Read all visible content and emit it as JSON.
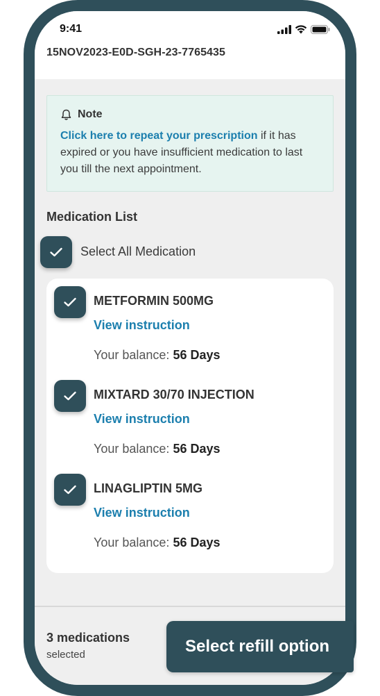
{
  "status_bar": {
    "time": "9:41"
  },
  "header": {
    "reference": "15NOV2023-E0D-SGH-23-7765435"
  },
  "note": {
    "title": "Note",
    "link_text": "Click here to repeat your prescription",
    "body_text": " if it has expired or you have insufficient medication to last you till the next appointment."
  },
  "medication_list": {
    "title": "Medication List",
    "select_all_label": "Select All Medication",
    "balance_prefix": "Your balance: ",
    "items": [
      {
        "name": "METFORMIN 500MG",
        "link": "View instruction",
        "balance": "56 Days",
        "checked": true
      },
      {
        "name": "MIXTARD 30/70 INJECTION",
        "link": "View instruction",
        "balance": "56 Days",
        "checked": true
      },
      {
        "name": "LINAGLIPTIN 5MG",
        "link": "View instruction",
        "balance": "56 Days",
        "checked": true
      }
    ]
  },
  "footer": {
    "count": "3 medications",
    "count_sub": "selected",
    "refill_button": "Select refill option"
  },
  "colors": {
    "primary": "#2f4f5a",
    "link": "#1c7fae",
    "note_bg": "#e6f4f0",
    "screen_bg": "#efefef"
  }
}
